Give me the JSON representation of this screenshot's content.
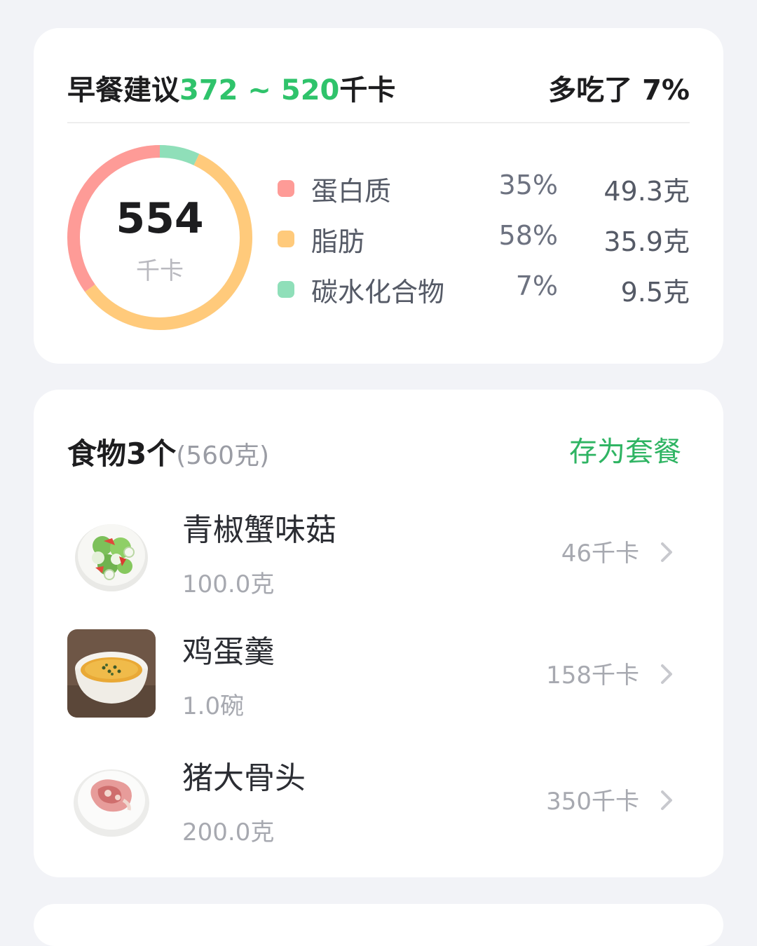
{
  "summary": {
    "title_prefix": "早餐建议",
    "title_range": "372 ~ 520",
    "title_unit": "千卡",
    "over_text": "多吃了 7%",
    "total_kcal": "554",
    "kcal_unit": "千卡",
    "macros": [
      {
        "name": "蛋白质",
        "percent": "35%",
        "amount": "49.3克",
        "color": "#fe9b97",
        "share": 0.35
      },
      {
        "name": "脂肪",
        "percent": "58%",
        "amount": "35.9克",
        "color": "#ffca7b",
        "share": 0.58
      },
      {
        "name": "碳水化合物",
        "percent": "7%",
        "amount": "9.5克",
        "color": "#8fdfb9",
        "share": 0.07
      }
    ]
  },
  "foods": {
    "title": "食物3个",
    "total_weight": "(560克)",
    "save_label": "存为套餐",
    "items": [
      {
        "name": "青椒蟹味菇",
        "quantity": "100.0克",
        "kcal": "46千卡",
        "icon": "salad-plate-icon"
      },
      {
        "name": "鸡蛋羹",
        "quantity": "1.0碗",
        "kcal": "158千卡",
        "icon": "egg-custard-bowl-icon"
      },
      {
        "name": "猪大骨头",
        "quantity": "200.0克",
        "kcal": "350千卡",
        "icon": "pork-bone-plate-icon"
      }
    ]
  }
}
